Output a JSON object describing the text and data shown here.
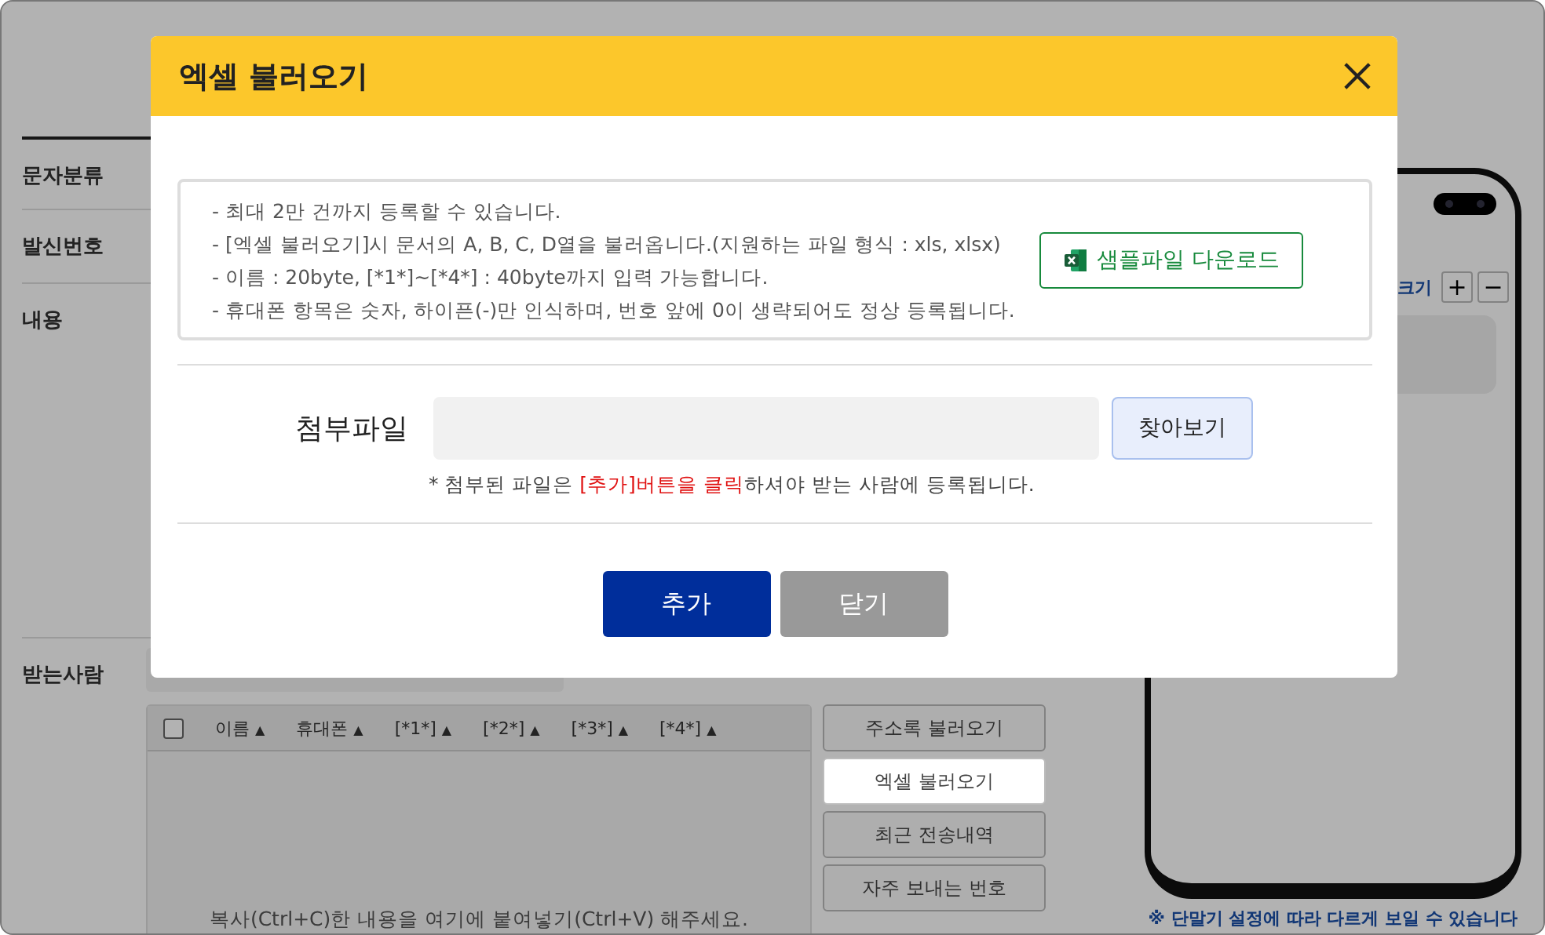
{
  "form": {
    "labels": [
      "문자분류",
      "발신번호",
      "내용",
      "받는사람"
    ]
  },
  "table": {
    "select_all": {
      "checked": false
    },
    "columns": [
      "이름",
      "휴대폰",
      "[*1*]",
      "[*2*]",
      "[*3*]",
      "[*4*]"
    ],
    "sort_mark": "▲",
    "paste_hint": "복사(Ctrl+C)한 내용을 여기에 붙여넣기(Ctrl+V) 해주세요."
  },
  "side_buttons": [
    {
      "label": "주소록 불러오기",
      "selected": false
    },
    {
      "label": "엑셀 불러오기",
      "selected": true
    },
    {
      "label": "최근 전송내역",
      "selected": false
    },
    {
      "label": "자주 보내는 번호",
      "selected": false
    }
  ],
  "preview": {
    "size_label": "크기",
    "zoom_in": "+",
    "zoom_out": "−",
    "note": "※ 단말기 설정에 따라 다르게 보일 수 있습니다"
  },
  "dialog": {
    "title": "엑셀 불러오기",
    "info_lines": [
      "- 최대 2만 건까지 등록할 수 있습니다.",
      "- [엑셀 불러오기]시 문서의 A, B, C, D열을 불러옵니다.(지원하는 파일 형식 : xls, xlsx)",
      "- 이름 : 20byte, [*1*]~[*4*] : 40byte까지 입력 가능합니다.",
      "- 휴대폰 항목은 숫자, 하이픈(-)만 인식하며, 번호 앞에 0이 생략되어도 정상 등록됩니다."
    ],
    "sample_button": "샘플파일 다운로드",
    "file_label": "첨부파일",
    "browse_button": "찾아보기",
    "note": {
      "before": "* 첨부된 파일은 ",
      "highlight": "[추가]버튼을 클릭",
      "after": "하셔야 받는 사람에 등록됩니다."
    },
    "buttons": [
      {
        "label": "추가",
        "kind": "primary"
      },
      {
        "label": "닫기",
        "kind": "secondary"
      }
    ]
  }
}
